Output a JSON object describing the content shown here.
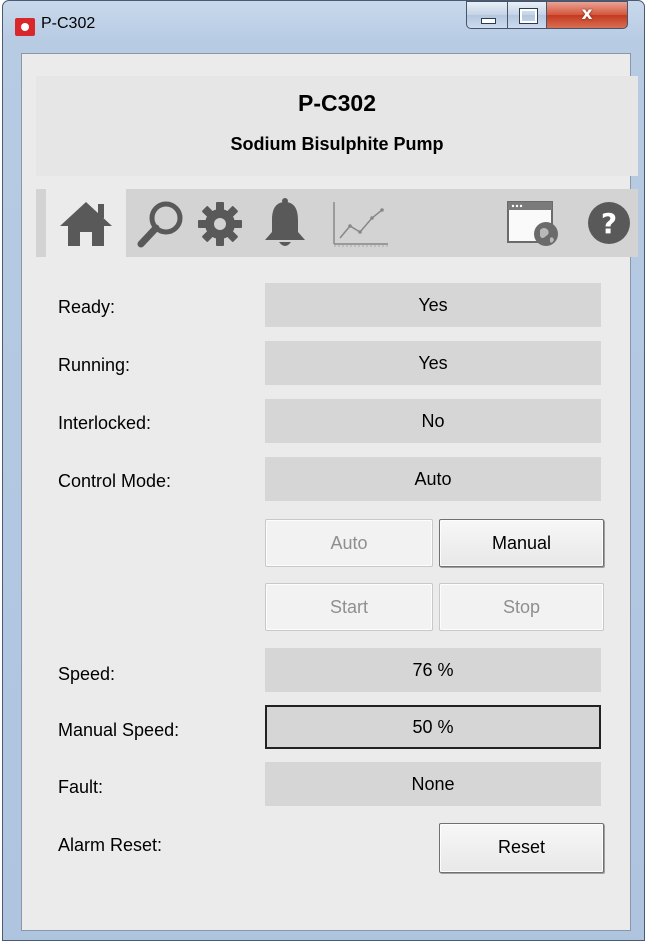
{
  "window": {
    "title": "P-C302",
    "close_glyph": "x"
  },
  "header": {
    "tag": "P-C302",
    "description": "Sodium Bisulphite Pump"
  },
  "tabs": [
    {
      "name": "home-icon",
      "active": true
    },
    {
      "name": "magnifier-icon",
      "active": false
    },
    {
      "name": "gear-icon",
      "active": false
    },
    {
      "name": "bell-icon",
      "active": false
    },
    {
      "name": "trend-chart-icon",
      "active": false
    },
    {
      "name": "web-window-icon",
      "active": false
    },
    {
      "name": "help-icon",
      "active": false
    }
  ],
  "fields": {
    "ready": {
      "label": "Ready:",
      "value": "Yes"
    },
    "running": {
      "label": "Running:",
      "value": "Yes"
    },
    "interlocked": {
      "label": "Interlocked:",
      "value": "No"
    },
    "control_mode": {
      "label": "Control Mode:",
      "value": "Auto"
    },
    "speed": {
      "label": "Speed:",
      "value": "76 %"
    },
    "manual_speed": {
      "label": "Manual Speed:",
      "value": "50 %"
    },
    "fault": {
      "label": "Fault:",
      "value": "None"
    },
    "alarm_reset": {
      "label": "Alarm Reset:"
    }
  },
  "buttons": {
    "auto": "Auto",
    "manual": "Manual",
    "start": "Start",
    "stop": "Stop",
    "reset": "Reset"
  },
  "colors": {
    "icon_gray": "#595959",
    "tab_bar": "#d3d3d3",
    "value_box": "#d6d6d6",
    "close_red": "#c43a1f"
  }
}
